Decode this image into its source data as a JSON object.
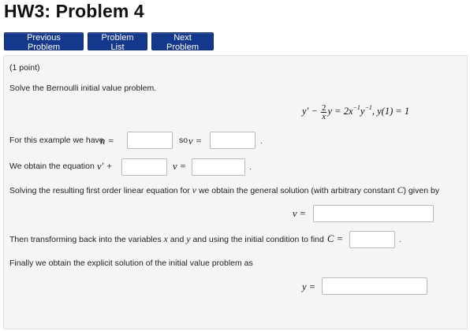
{
  "page": {
    "title": "HW3: Problem 4"
  },
  "nav": {
    "previous_label": "Previous Problem",
    "list_label": "Problem List",
    "next_label": "Next Problem"
  },
  "problem": {
    "points": "(1 point)",
    "prompt": "Solve the Bernoulli initial value problem.",
    "equation": {
      "lhs_start": "y′ − ",
      "frac_num": "2",
      "frac_den": "x",
      "lhs_rest": "y = 2x",
      "exp1": "−1",
      "mid": "y",
      "exp2": "−1",
      "condition": ",   y(1) = 1"
    },
    "line1": {
      "prefix": "For this example we have ",
      "n_label": "n =",
      "so_text": "so ",
      "v_label": "v =",
      "n_value": "",
      "v_value": ""
    },
    "line2": {
      "prefix": "We obtain the equation ",
      "vprime_label": "v′ +",
      "v_eq_label": "v =",
      "coef_value": "",
      "rhs_value": ""
    },
    "line3": {
      "text_start": "Solving the resulting first order linear equation for ",
      "var": "v",
      "text_mid": " we obtain the general solution (with arbitrary constant ",
      "const": "C",
      "text_end": ") given by"
    },
    "general": {
      "label": "v =",
      "value": ""
    },
    "line4": {
      "text_start": "Then transforming back into the variables ",
      "x": "x",
      "and": " and ",
      "y": "y",
      "text_end": " and using the initial condition to find ",
      "c_label": "C =",
      "c_value": ""
    },
    "line5": {
      "text": "Finally we obtain the explicit solution of the initial value problem as"
    },
    "explicit": {
      "label": "y =",
      "value": ""
    }
  }
}
